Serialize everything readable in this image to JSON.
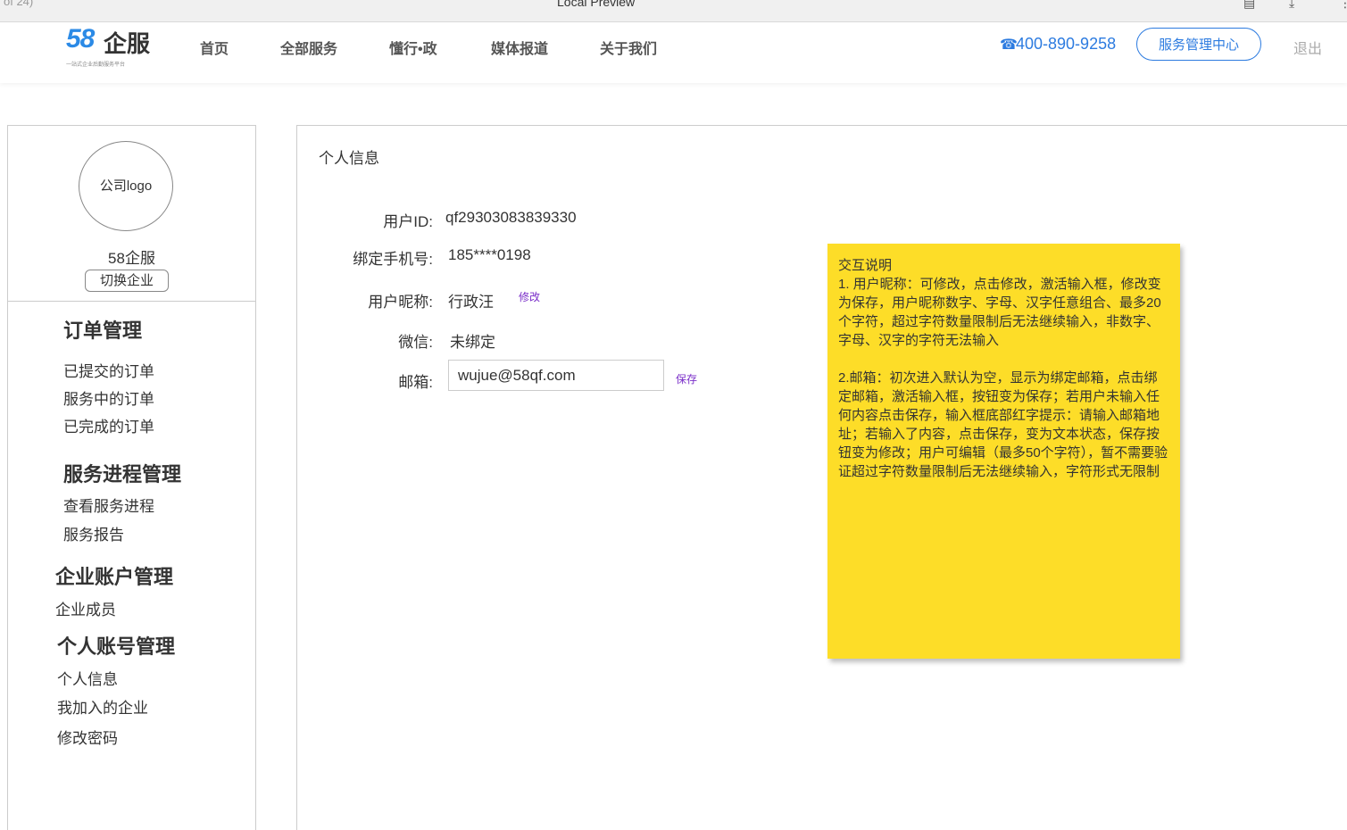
{
  "preview": {
    "page_count": "of 24)",
    "title": "Local Preview"
  },
  "header": {
    "logo": {
      "number": "58",
      "name": "企服",
      "tagline": "一站式企业后勤服务平台"
    },
    "nav": [
      "首页",
      "全部服务",
      "懂行•政",
      "媒体报道",
      "关于我们"
    ],
    "phone": "400-890-9258",
    "service_center": "服务管理中心",
    "logout": "退出"
  },
  "sidebar": {
    "avatar_label": "公司logo",
    "company_name": "58企服",
    "switch_label": "切换企业",
    "sections": [
      {
        "title": "订单管理",
        "items": [
          "已提交的订单",
          "服务中的订单",
          "已完成的订单"
        ]
      },
      {
        "title": "服务进程管理",
        "items": [
          "查看服务进程",
          "服务报告"
        ]
      },
      {
        "title": "企业账户管理",
        "items": [
          "企业成员"
        ]
      },
      {
        "title": "个人账号管理",
        "items": [
          "个人信息",
          "我加入的企业",
          "修改密码"
        ]
      }
    ]
  },
  "main": {
    "title": "个人信息",
    "fields": {
      "user_id": {
        "label": "用户ID:",
        "value": "qf29303083839330"
      },
      "phone": {
        "label": "绑定手机号:",
        "value": "185****0198"
      },
      "nickname": {
        "label": "用户昵称:",
        "value": "行政汪",
        "action": "修改"
      },
      "wechat": {
        "label": "微信:",
        "value": "未绑定"
      },
      "email": {
        "label": "邮箱:",
        "value": "wujue@58qf.com",
        "action": "保存"
      }
    }
  },
  "note": {
    "title": "交互说明",
    "paragraph1": "1. 用户昵称：可修改，点击修改，激活输入框，修改变为保存，用户昵称数字、字母、汉字任意组合、最多20个字符，超过字符数量限制后无法继续输入，非数字、字母、汉字的字符无法输入",
    "paragraph2": "2.邮箱：初次进入默认为空，显示为绑定邮箱，点击绑定邮箱，激活输入框，按钮变为保存；若用户未输入任何内容点击保存，输入框底部红字提示：请输入邮箱地址；若输入了内容，点击保存，变为文本状态，保存按钮变为修改；用户可编辑（最多50个字符），暂不需要验证超过字符数量限制后无法继续输入，字符形式无限制"
  },
  "colors": {
    "brand_blue": "#2c7be0",
    "brand_orange": "#f26b21",
    "note_yellow": "#fddd28",
    "link_purple": "#7b2fc9"
  }
}
